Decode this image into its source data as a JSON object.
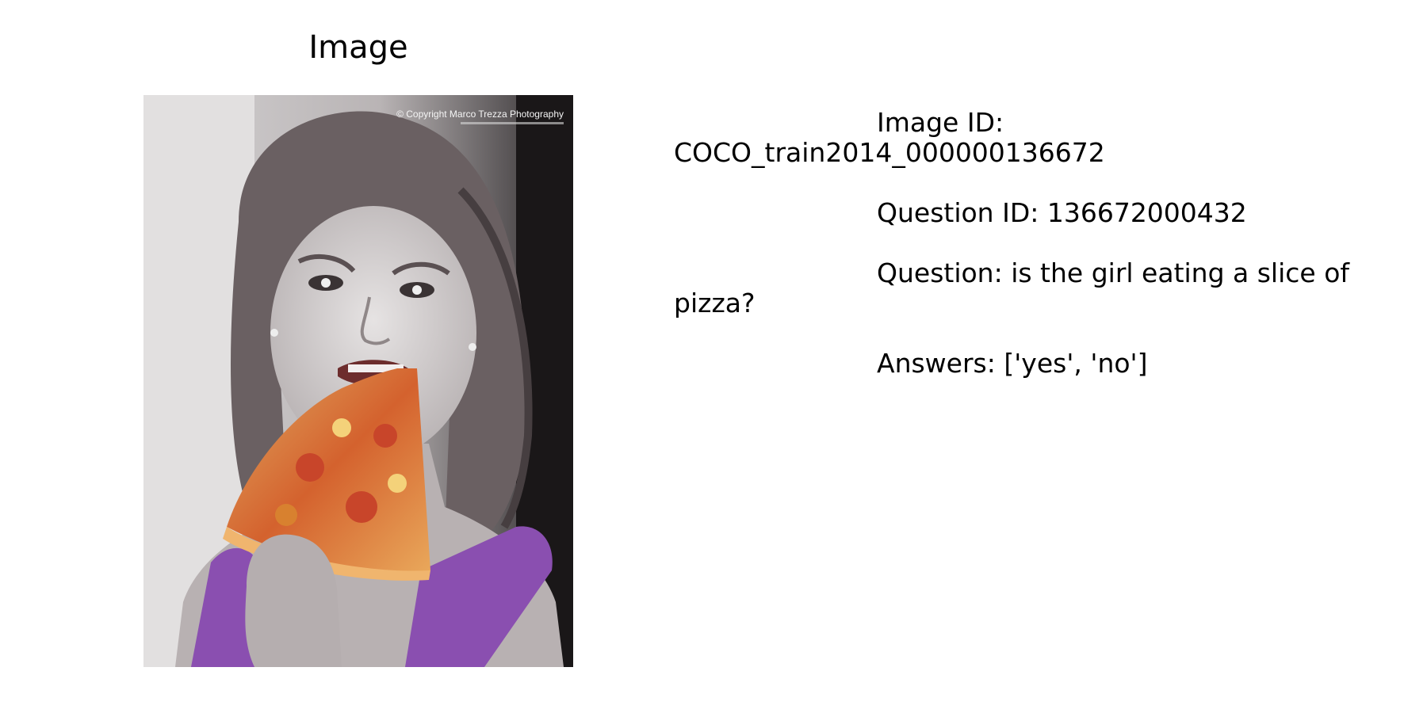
{
  "panel_title": "Image",
  "photo": {
    "watermark": "© Copyright Marco Trezza Photography"
  },
  "info": {
    "image_id": "Image ID: COCO_train2014_000000136672",
    "question_id": "Question ID: 136672000432",
    "question": "Question: is the girl eating a slice of pizza?",
    "answers": "Answers: ['yes', 'no']"
  }
}
